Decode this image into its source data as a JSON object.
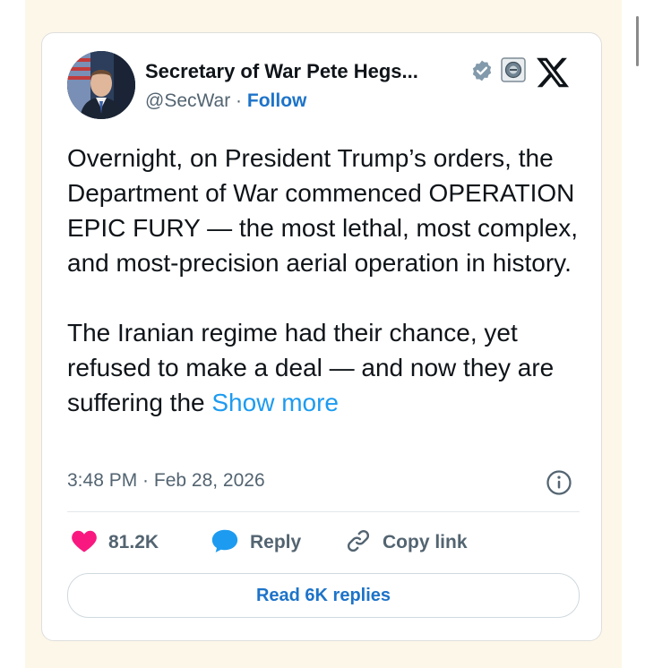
{
  "tweet": {
    "author_name": "Secretary of War Pete Hegs...",
    "handle": "@SecWar",
    "separator": " · ",
    "follow_label": "Follow",
    "paragraph_1": "Overnight, on President Trump’s orders, the Department of War commenced OPERATION EPIC FURY — the most lethal, most complex, and most-precision aerial operation in history.",
    "paragraph_2": "The Iranian regime had their chance, yet refused to make a deal — and now they are suffering the ",
    "show_more_label": "Show more",
    "timestamp": "3:48 PM · Feb 28, 2026"
  },
  "actions": {
    "like_count": "81.2K",
    "reply_label": "Reply",
    "copy_link_label": "Copy link",
    "read_replies_label": "Read 6K replies"
  },
  "icons": {
    "verified_badge": "verified-badge-icon",
    "affiliate_badge": "government-affiliate-icon",
    "x_logo": "x-logo-icon",
    "info": "info-icon",
    "heart": "heart-icon",
    "reply": "reply-bubble-icon",
    "link": "link-icon"
  },
  "colors": {
    "page_background": "#fdf7e9",
    "card_background": "#ffffff",
    "text_primary": "#0f1419",
    "text_secondary": "#536471",
    "link_blue": "#1d9bf0",
    "follow_blue": "#1d73c9",
    "heart_pink": "#f91880",
    "reply_blue": "#1d9bf0"
  }
}
